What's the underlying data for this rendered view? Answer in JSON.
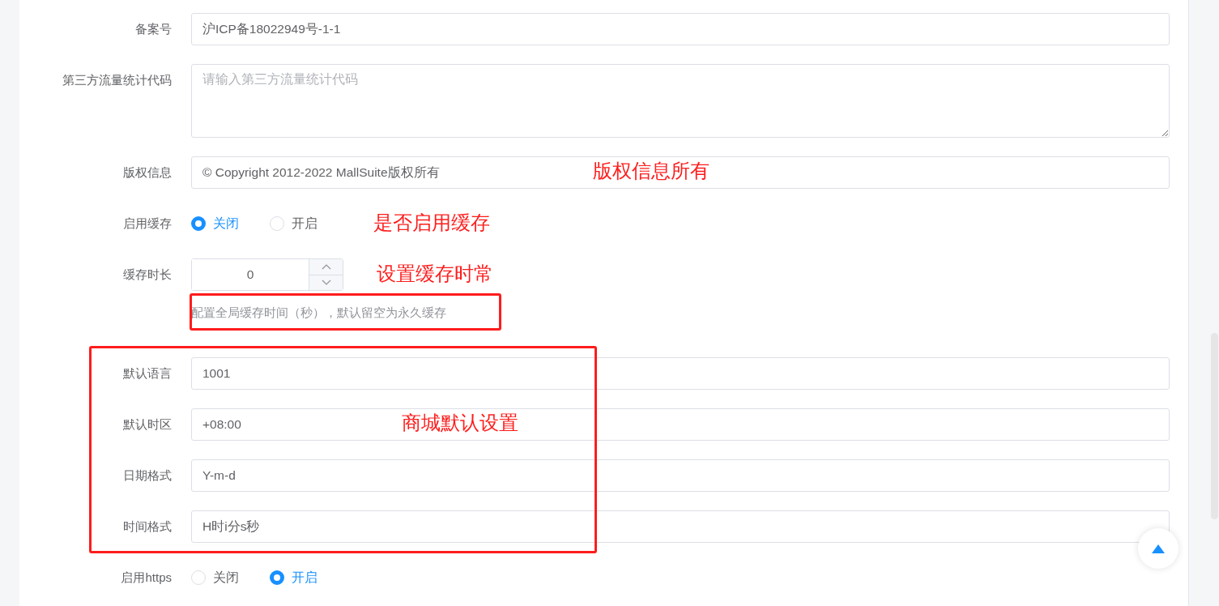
{
  "fields": [
    {
      "kind": "text",
      "label": "备案号",
      "value": "沪ICP备18022949号-1-1"
    },
    {
      "kind": "textarea",
      "label": "第三方流量统计代码",
      "placeholder": "请输入第三方流量统计代码"
    },
    {
      "kind": "text",
      "label": "版权信息",
      "value": "© Copyright 2012-2022 MallSuite版权所有",
      "note": "版权信息所有"
    },
    {
      "kind": "radio",
      "label": "启用缓存",
      "options": [
        {
          "label": "关闭",
          "selected": true
        },
        {
          "label": "开启",
          "selected": false
        }
      ],
      "note": "是否启用缓存"
    },
    {
      "kind": "number",
      "label": "缓存时长",
      "value": "0",
      "hint": "配置全局缓存时间（秒），默认留空为永久缓存",
      "hint_framed": true,
      "note": "设置缓存时常"
    },
    {
      "kind": "group",
      "framed": true,
      "note": "商城默认设置",
      "fields": [
        {
          "kind": "text",
          "label": "默认语言",
          "value": "1001"
        },
        {
          "kind": "text",
          "label": "默认时区",
          "value": "+08:00"
        },
        {
          "kind": "text",
          "label": "日期格式",
          "value": "Y-m-d"
        },
        {
          "kind": "text",
          "label": "时间格式",
          "value": "H时i分s秒"
        }
      ]
    },
    {
      "kind": "radio",
      "label": "启用https",
      "options": [
        {
          "label": "关闭",
          "selected": false
        },
        {
          "label": "开启",
          "selected": true
        }
      ]
    }
  ]
}
